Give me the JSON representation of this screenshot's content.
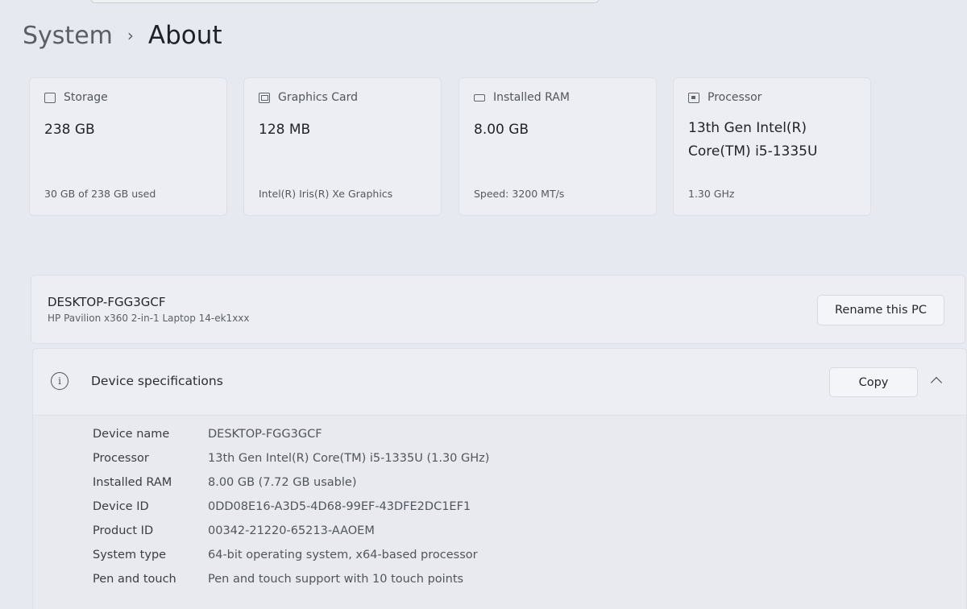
{
  "breadcrumb": {
    "parent": "System",
    "separator": "›",
    "current": "About"
  },
  "cards": [
    {
      "title": "Storage",
      "icon": "storage-icon",
      "value": "238 GB",
      "sub": "30 GB of 238 GB used"
    },
    {
      "title": "Graphics Card",
      "icon": "graphics-card-icon",
      "value": "128 MB",
      "sub": "Intel(R) Iris(R) Xe Graphics"
    },
    {
      "title": "Installed RAM",
      "icon": "ram-icon",
      "value": "8.00 GB",
      "sub": "Speed: 3200 MT/s"
    },
    {
      "title": "Processor",
      "icon": "processor-icon",
      "value": "13th Gen Intel(R) Core(TM) i5-1335U",
      "sub": "1.30 GHz"
    }
  ],
  "pc": {
    "name": "DESKTOP-FGG3GCF",
    "model": "HP Pavilion x360 2-in-1 Laptop 14-ek1xxx",
    "rename_label": "Rename this PC"
  },
  "specs": {
    "title": "Device specifications",
    "copy_label": "Copy",
    "rows": [
      {
        "label": "Device name",
        "value": "DESKTOP-FGG3GCF"
      },
      {
        "label": "Processor",
        "value": "13th Gen Intel(R) Core(TM) i5-1335U (1.30 GHz)"
      },
      {
        "label": "Installed RAM",
        "value": "8.00 GB (7.72 GB usable)"
      },
      {
        "label": "Device ID",
        "value": "0DD08E16-A3D5-4D68-99EF-43DFE2DC1EF1"
      },
      {
        "label": "Product ID",
        "value": "00342-21220-65213-AAOEM"
      },
      {
        "label": "System type",
        "value": "64-bit operating system, x64-based processor"
      },
      {
        "label": "Pen and touch",
        "value": "Pen and touch support with 10 touch points"
      }
    ]
  }
}
